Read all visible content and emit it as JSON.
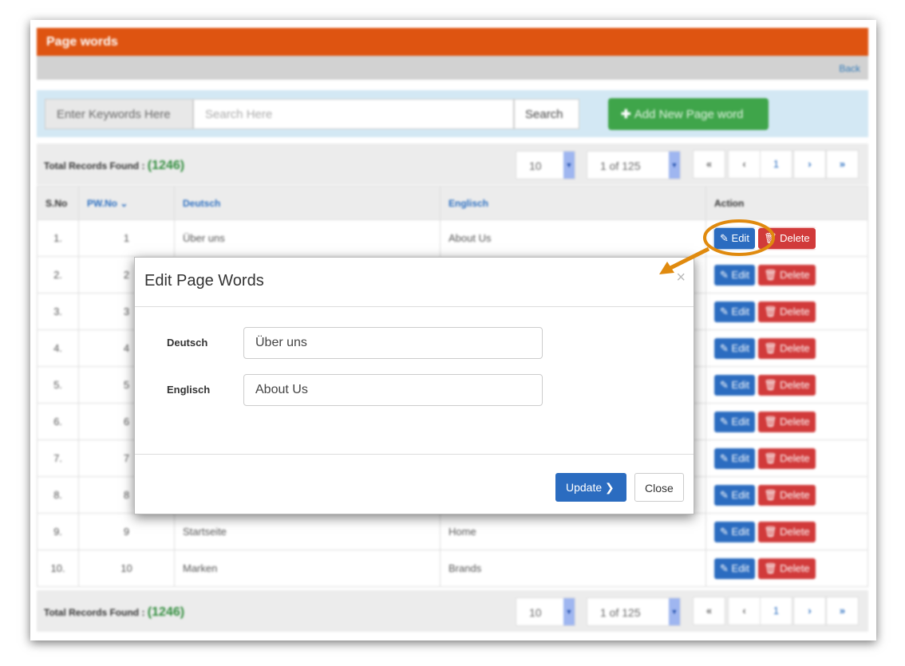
{
  "page": {
    "title": "Page words",
    "back": "Back"
  },
  "search": {
    "label": "Enter Keywords Here",
    "placeholder": "Search Here",
    "button": "Search",
    "add": "Add New Page word"
  },
  "toolbar": {
    "total_label": "Total Records Found :",
    "total": "(1246)",
    "page_size": "10",
    "page_of": "1 of 125",
    "current_page": "1"
  },
  "table": {
    "headers": [
      "S.No",
      "PW.No",
      "Deutsch",
      "Englisch",
      "Action"
    ],
    "rows": [
      {
        "sno": "1.",
        "pw": "1",
        "de": "Über uns",
        "en": "About Us"
      },
      {
        "sno": "2.",
        "pw": "2",
        "de": "",
        "en": ""
      },
      {
        "sno": "3.",
        "pw": "3",
        "de": "",
        "en": ""
      },
      {
        "sno": "4.",
        "pw": "4",
        "de": "",
        "en": ""
      },
      {
        "sno": "5.",
        "pw": "5",
        "de": "",
        "en": ""
      },
      {
        "sno": "6.",
        "pw": "6",
        "de": "",
        "en": ""
      },
      {
        "sno": "7.",
        "pw": "7",
        "de": "",
        "en": ""
      },
      {
        "sno": "8.",
        "pw": "8",
        "de": "",
        "en": ""
      },
      {
        "sno": "9.",
        "pw": "9",
        "de": "Startseite",
        "en": "Home"
      },
      {
        "sno": "10.",
        "pw": "10",
        "de": "Marken",
        "en": "Brands"
      }
    ],
    "edit": "Edit",
    "delete": "Delete"
  },
  "modal": {
    "title": "Edit Page Words",
    "close_x": "×",
    "deutsch_label": "Deutsch",
    "deutsch_value": "Über uns",
    "englisch_label": "Englisch",
    "englisch_value": "About Us",
    "update": "Update",
    "close": "Close"
  },
  "colors": {
    "header": "#de5411",
    "primary": "#2b6cc0",
    "danger": "#d13a3a",
    "success": "#3fa54a",
    "annotation": "#e08a0e"
  }
}
